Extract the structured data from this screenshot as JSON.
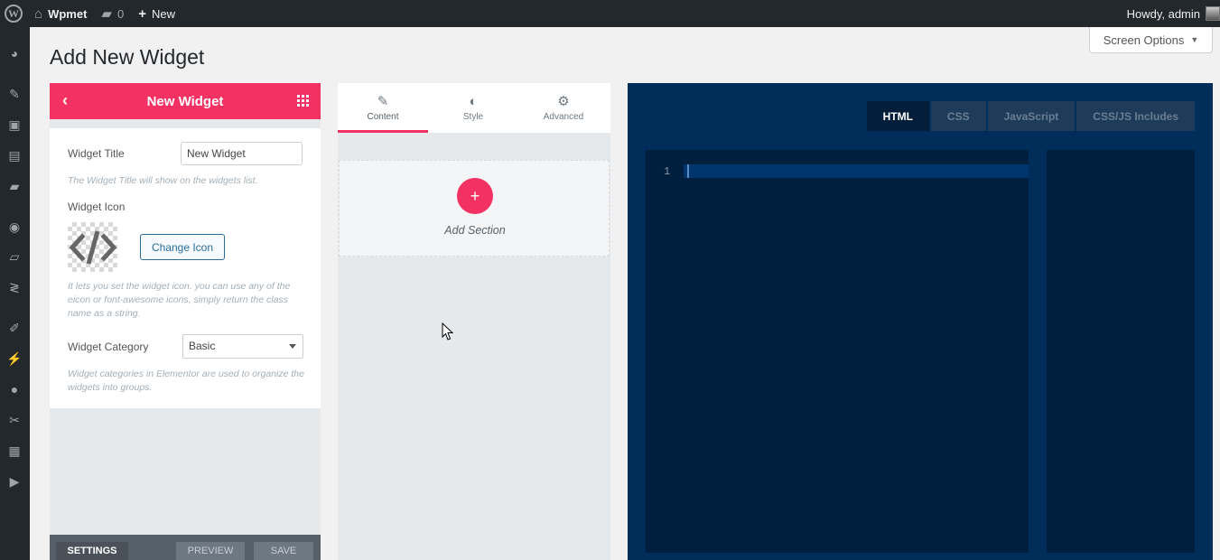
{
  "adminbar": {
    "site_name": "Wpmet",
    "comments_count": "0",
    "new_label": "New",
    "greeting": "Howdy, admin",
    "icons": {
      "wp_logo": "wordpress-logo-icon",
      "home": "home-icon",
      "comments": "comment-bubble-icon",
      "new": "plus-icon"
    }
  },
  "sidebar": {
    "icons": [
      "dashboard-icon",
      "pin-icon",
      "media-icon",
      "pages-icon",
      "comments-icon",
      "elementor-icon",
      "folder-icon",
      "elementskit-icon",
      "brush-icon",
      "plugins-icon",
      "users-icon",
      "tools-icon",
      "settings-icon",
      "play-icon"
    ]
  },
  "header": {
    "title": "Add New Widget",
    "screen_options": "Screen Options"
  },
  "left_panel": {
    "title": "New Widget",
    "widget_title_label": "Widget Title",
    "widget_title_value": "New Widget",
    "widget_title_hint": "The Widget Title will show on the widgets list.",
    "widget_icon_label": "Widget Icon",
    "change_icon_label": "Change Icon",
    "widget_icon_hint": "It lets you set the widget icon. you can use any of the eicon or font-awesome icons, simply return the class name as a string.",
    "widget_category_label": "Widget Category",
    "widget_category_value": "Basic",
    "widget_category_hint": "Widget categories in Elementor are used to organize the widgets into groups.",
    "footer": {
      "settings": "SETTINGS",
      "preview": "PREVIEW",
      "save": "SAVE"
    }
  },
  "mid_panel": {
    "tabs": [
      {
        "label": "Content",
        "icon": "pencil-icon"
      },
      {
        "label": "Style",
        "icon": "half-circle-icon"
      },
      {
        "label": "Advanced",
        "icon": "gear-icon"
      }
    ],
    "add_section_label": "Add Section"
  },
  "code_panel": {
    "tabs": [
      "HTML",
      "CSS",
      "JavaScript",
      "CSS/JS Includes"
    ],
    "active_tab": "HTML",
    "line_number": "1"
  },
  "colors": {
    "accent": "#f33162",
    "editor_bg": "#002d5a",
    "admin_bar": "#23282d"
  }
}
